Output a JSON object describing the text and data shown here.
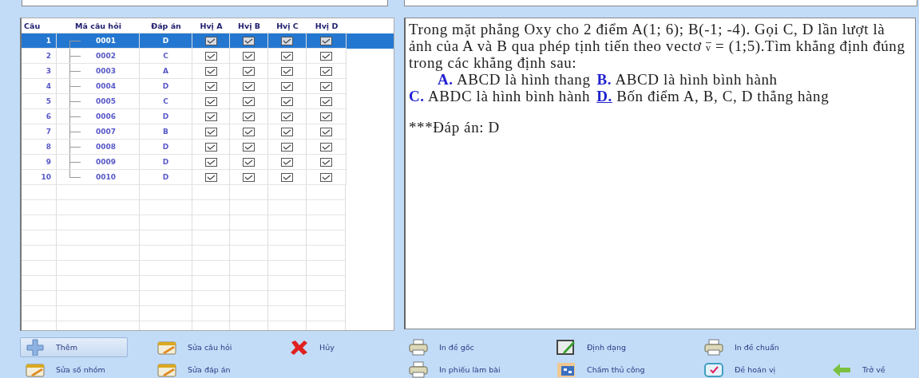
{
  "table": {
    "columns": [
      "Câu",
      "Mã câu hỏi",
      "Đáp án",
      "Hvị A",
      "Hvị B",
      "Hvị C",
      "Hvị D"
    ],
    "rows": [
      {
        "number": "1",
        "code": "0001",
        "answer": "D",
        "checks": [
          true,
          true,
          true,
          true
        ],
        "selected": true
      },
      {
        "number": "2",
        "code": "0002",
        "answer": "C",
        "checks": [
          true,
          true,
          true,
          true
        ],
        "selected": false
      },
      {
        "number": "3",
        "code": "0003",
        "answer": "A",
        "checks": [
          true,
          true,
          true,
          true
        ],
        "selected": false
      },
      {
        "number": "4",
        "code": "0004",
        "answer": "D",
        "checks": [
          true,
          true,
          true,
          true
        ],
        "selected": false
      },
      {
        "number": "5",
        "code": "0005",
        "answer": "C",
        "checks": [
          true,
          true,
          true,
          true
        ],
        "selected": false
      },
      {
        "number": "6",
        "code": "0006",
        "answer": "D",
        "checks": [
          true,
          true,
          true,
          true
        ],
        "selected": false
      },
      {
        "number": "7",
        "code": "0007",
        "answer": "B",
        "checks": [
          true,
          true,
          true,
          true
        ],
        "selected": false
      },
      {
        "number": "8",
        "code": "0008",
        "answer": "D",
        "checks": [
          true,
          true,
          true,
          true
        ],
        "selected": false
      },
      {
        "number": "9",
        "code": "0009",
        "answer": "D",
        "checks": [
          true,
          true,
          true,
          true
        ],
        "selected": false
      },
      {
        "number": "10",
        "code": "0010",
        "answer": "D",
        "checks": [
          true,
          true,
          true,
          true
        ],
        "selected": false
      }
    ]
  },
  "preview": {
    "question_before": "Trong mặt phẳng Oxy cho 2 điểm A(1; 6); B(-1; -4). Gọi C, D lần lượt là ảnh của A và B qua phép tịnh tiến theo vectơ",
    "vector": "v",
    "question_after": "= (1;5).Tìm khẳng định đúng trong các khẳng định sau:",
    "options": [
      {
        "label": "A.",
        "text": "ABCD là hình thang",
        "correct": false
      },
      {
        "label": "B.",
        "text": "ABCD là hình bình hành",
        "correct": false
      },
      {
        "label": "C.",
        "text": "ABDC là hình bình hành",
        "correct": false
      },
      {
        "label": "D.",
        "text": "Bốn điểm A, B, C, D thẳng hàng",
        "correct": true
      }
    ],
    "answer": "***Đáp án: D"
  },
  "toolbar": {
    "edit_group": [
      [
        {
          "label": "Thêm",
          "kind": "plus",
          "focused": true
        },
        {
          "label": "Sửa câu hỏi",
          "kind": "edit",
          "focused": false
        },
        {
          "label": "Hủy",
          "kind": "cross",
          "focused": false
        }
      ],
      [
        {
          "label": "Sửa số nhóm",
          "kind": "edit",
          "focused": false
        },
        {
          "label": "Sửa đáp án",
          "kind": "edit",
          "focused": false
        }
      ]
    ],
    "print_group": [
      [
        {
          "label": "In đề gốc",
          "kind": "printer",
          "focused": false
        },
        {
          "label": "Định dạng",
          "kind": "format",
          "focused": false
        },
        {
          "label": "In đề chuẩn",
          "kind": "printer",
          "focused": false
        }
      ],
      [
        {
          "label": "In phiếu làm bài",
          "kind": "printer",
          "focused": false
        },
        {
          "label": "Chấm thủ công",
          "kind": "grid",
          "focused": false
        },
        {
          "label": "Đề hoán vị",
          "kind": "shuffle",
          "focused": false
        },
        {
          "label": "Trở về",
          "kind": "back",
          "focused": false
        }
      ]
    ]
  }
}
